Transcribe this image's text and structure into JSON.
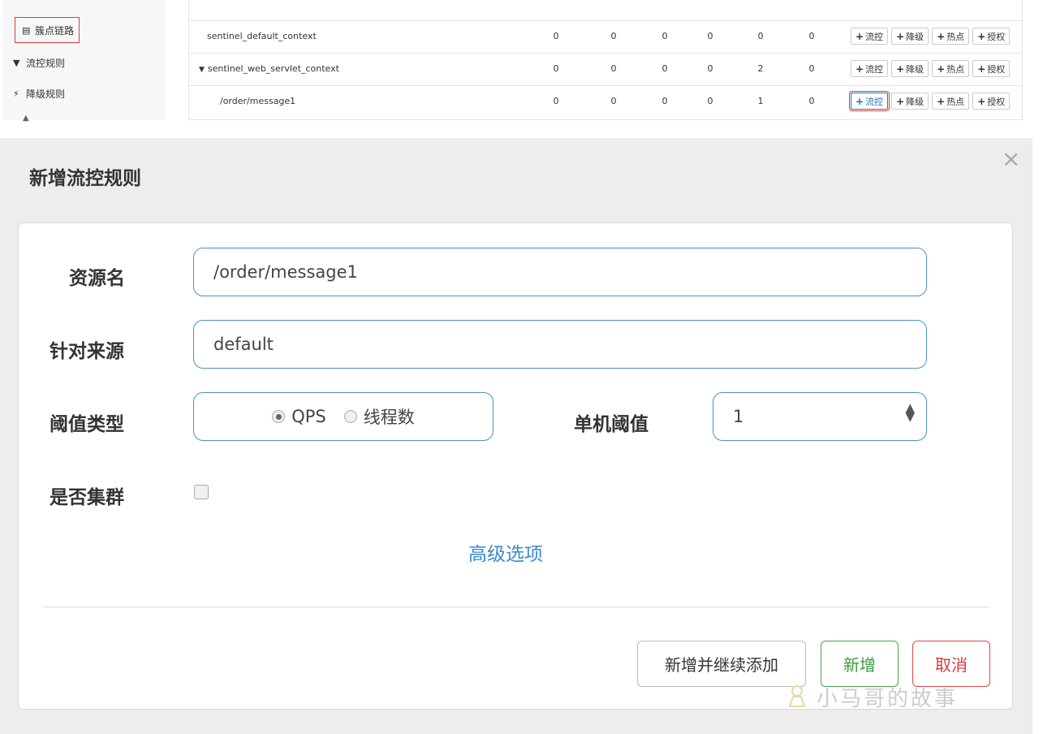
{
  "sidebar": {
    "items": [
      {
        "icon": "list-icon",
        "glyph": "▤",
        "label": "簇点链路"
      },
      {
        "icon": "filter-icon",
        "glyph": "▼",
        "label": "流控规则"
      },
      {
        "icon": "bolt-icon",
        "glyph": "⚡",
        "label": "降级规则"
      }
    ]
  },
  "table": {
    "rows": [
      {
        "name": "sentinel_default_context",
        "values": [
          "0",
          "0",
          "0",
          "0",
          "0",
          "0"
        ]
      },
      {
        "name": "sentinel_web_servlet_context",
        "expand": "▼",
        "values": [
          "0",
          "0",
          "0",
          "0",
          "2",
          "0"
        ]
      },
      {
        "name": "/order/message1",
        "values": [
          "0",
          "0",
          "0",
          "0",
          "1",
          "0"
        ]
      }
    ],
    "op_labels": {
      "flow": "流控",
      "degrade": "降级",
      "hot": "热点",
      "auth": "授权"
    },
    "plus": "+"
  },
  "modal": {
    "title": "新增流控规则",
    "close": "×",
    "resource_label": "资源名",
    "resource_value": "/order/message1",
    "limit_app_label": "针对来源",
    "limit_app_value": "default",
    "grade_label": "阈值类型",
    "grade_options": [
      "QPS",
      "线程数"
    ],
    "grade_selected": "QPS",
    "count_label": "单机阈值",
    "count_value": "1",
    "cluster_label": "是否集群",
    "advanced_label": "高级选项",
    "buttons": {
      "add_more": "新增并继续添加",
      "add": "新增",
      "cancel": "取消"
    },
    "watermark": "小马哥的故事"
  }
}
